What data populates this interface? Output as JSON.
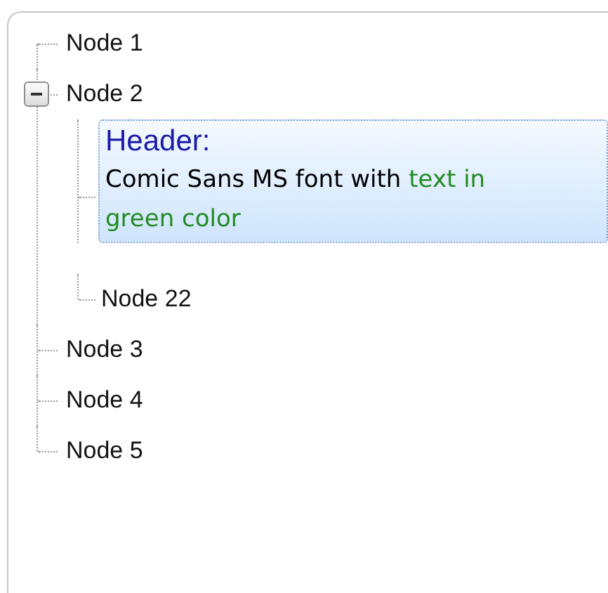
{
  "tree": {
    "nodes": [
      {
        "kind": "text",
        "label": "Node 1",
        "selected": false
      },
      {
        "kind": "text",
        "label": "Node 2",
        "selected": false,
        "expanded": true,
        "children": [
          {
            "kind": "rich",
            "header": "Header:",
            "body": [
              {
                "text": "Comic Sans MS font with ",
                "color": "#000000"
              },
              {
                "text": "text in green color",
                "color": "#228b22"
              }
            ],
            "selected": true
          },
          {
            "kind": "text",
            "label": "Node 22",
            "selected": false
          }
        ]
      },
      {
        "kind": "text",
        "label": "Node 3",
        "selected": false
      },
      {
        "kind": "text",
        "label": "Node 4",
        "selected": false
      },
      {
        "kind": "text",
        "label": "Node 5",
        "selected": false
      }
    ]
  }
}
